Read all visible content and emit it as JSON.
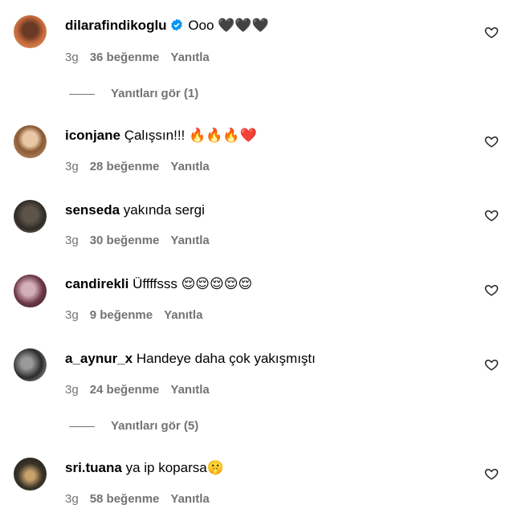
{
  "comments": [
    {
      "username": "dilarafindikoglu",
      "verified": true,
      "text": "Ooo 🖤🖤🖤",
      "time": "3g",
      "likes": "36 beğenme",
      "reply_label": "Yanıtla",
      "view_replies": "Yanıtları gör (1)"
    },
    {
      "username": "iconjane",
      "verified": false,
      "text": "Çalışsın!!! 🔥🔥🔥❤️",
      "time": "3g",
      "likes": "28 beğenme",
      "reply_label": "Yanıtla"
    },
    {
      "username": "senseda",
      "verified": false,
      "text": "yakında sergi",
      "time": "3g",
      "likes": "30 beğenme",
      "reply_label": "Yanıtla"
    },
    {
      "username": "candirekli",
      "verified": false,
      "text": "Üffffsss 😌😌😌😌😌",
      "time": "3g",
      "likes": "9 beğenme",
      "reply_label": "Yanıtla"
    },
    {
      "username": "a_aynur_x",
      "verified": false,
      "text": "Handeye daha çok yakışmıştı",
      "time": "3g",
      "likes": "24 beğenme",
      "reply_label": "Yanıtla",
      "view_replies": "Yanıtları gör (5)"
    },
    {
      "username": "sri.tuana",
      "verified": false,
      "text": "ya ip koparsa🤫",
      "time": "3g",
      "likes": "58 beğenme",
      "reply_label": "Yanıtla"
    }
  ],
  "colors": {
    "secondary_text": "#737373",
    "verified_badge": "#0095f6"
  },
  "icons": {
    "like": "heart-outline-icon",
    "verified": "verified-badge-icon"
  }
}
